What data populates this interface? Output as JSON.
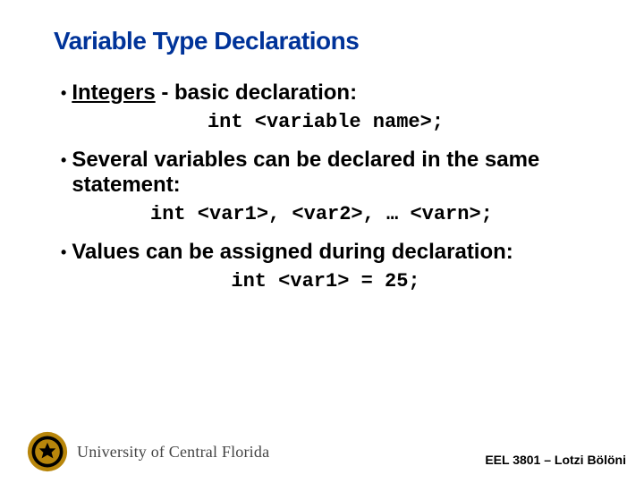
{
  "title": "Variable Type Declarations",
  "bullets": [
    {
      "underlined": "Integers",
      "rest": " - basic declaration:"
    },
    {
      "text": "Several variables can be declared in the same statement:"
    },
    {
      "text": "Values can be assigned during declaration:"
    }
  ],
  "code": [
    "int <variable name>;",
    "int <var1>, <var2>, … <varn>;",
    "int <var1> = 25;"
  ],
  "footer": {
    "university": "University of Central Florida",
    "course": "EEL 3801 – Lotzi Bölöni"
  }
}
